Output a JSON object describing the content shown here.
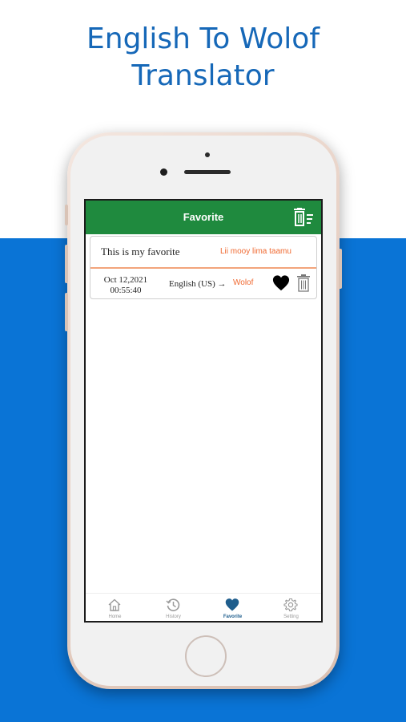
{
  "promo": {
    "title_line1": "English To Wolof",
    "title_line2": "Translator"
  },
  "colors": {
    "background_blue": "#0a74d6",
    "header_green": "#1f8a3e",
    "accent_orange": "#f06a32",
    "active_tab": "#1f5e8d"
  },
  "header": {
    "title": "Favorite",
    "clear_icon": "clear-all-delete-icon"
  },
  "favorites": [
    {
      "source_text": "This is my favorite",
      "translated_text": "Lii mooy lima taamu",
      "date": "Oct 12,2021",
      "time": "00:55:40",
      "from_language": "English (US) →",
      "to_language": "Wolof",
      "favorite_icon": "heart-filled-icon",
      "delete_icon": "trash-icon"
    }
  ],
  "tabs": [
    {
      "label": "Home",
      "icon": "home-icon"
    },
    {
      "label": "History",
      "icon": "history-icon"
    },
    {
      "label": "Favorite",
      "icon": "heart-icon"
    },
    {
      "label": "Setting",
      "icon": "gear-icon"
    }
  ],
  "active_tab": "Favorite"
}
